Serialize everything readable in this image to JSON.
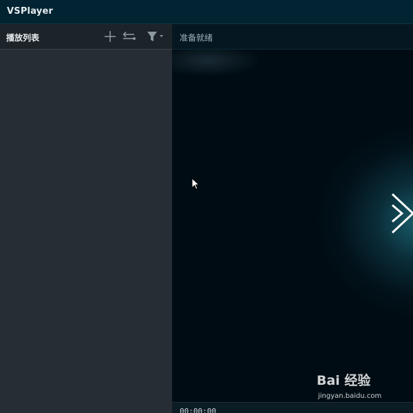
{
  "app": {
    "title": "VSPlayer"
  },
  "playlist": {
    "title": "播放列表",
    "toolbar": {
      "add_icon": "plus-icon",
      "loop_icon": "loop-mode-icon",
      "filter_icon": "filter-dropdown-icon"
    },
    "items": []
  },
  "player": {
    "status": "准备就绪",
    "time": "00:00:00",
    "logo_icon": "vsplayer-chevron-logo"
  },
  "watermark": {
    "brand": "Bai 经验",
    "url": "jingyan.baidu.com"
  },
  "colors": {
    "titlebar_bg": "#022331",
    "panel_bg": "#262d34",
    "video_bg": "#000c13",
    "accent_glow": "#1e6e7d"
  }
}
